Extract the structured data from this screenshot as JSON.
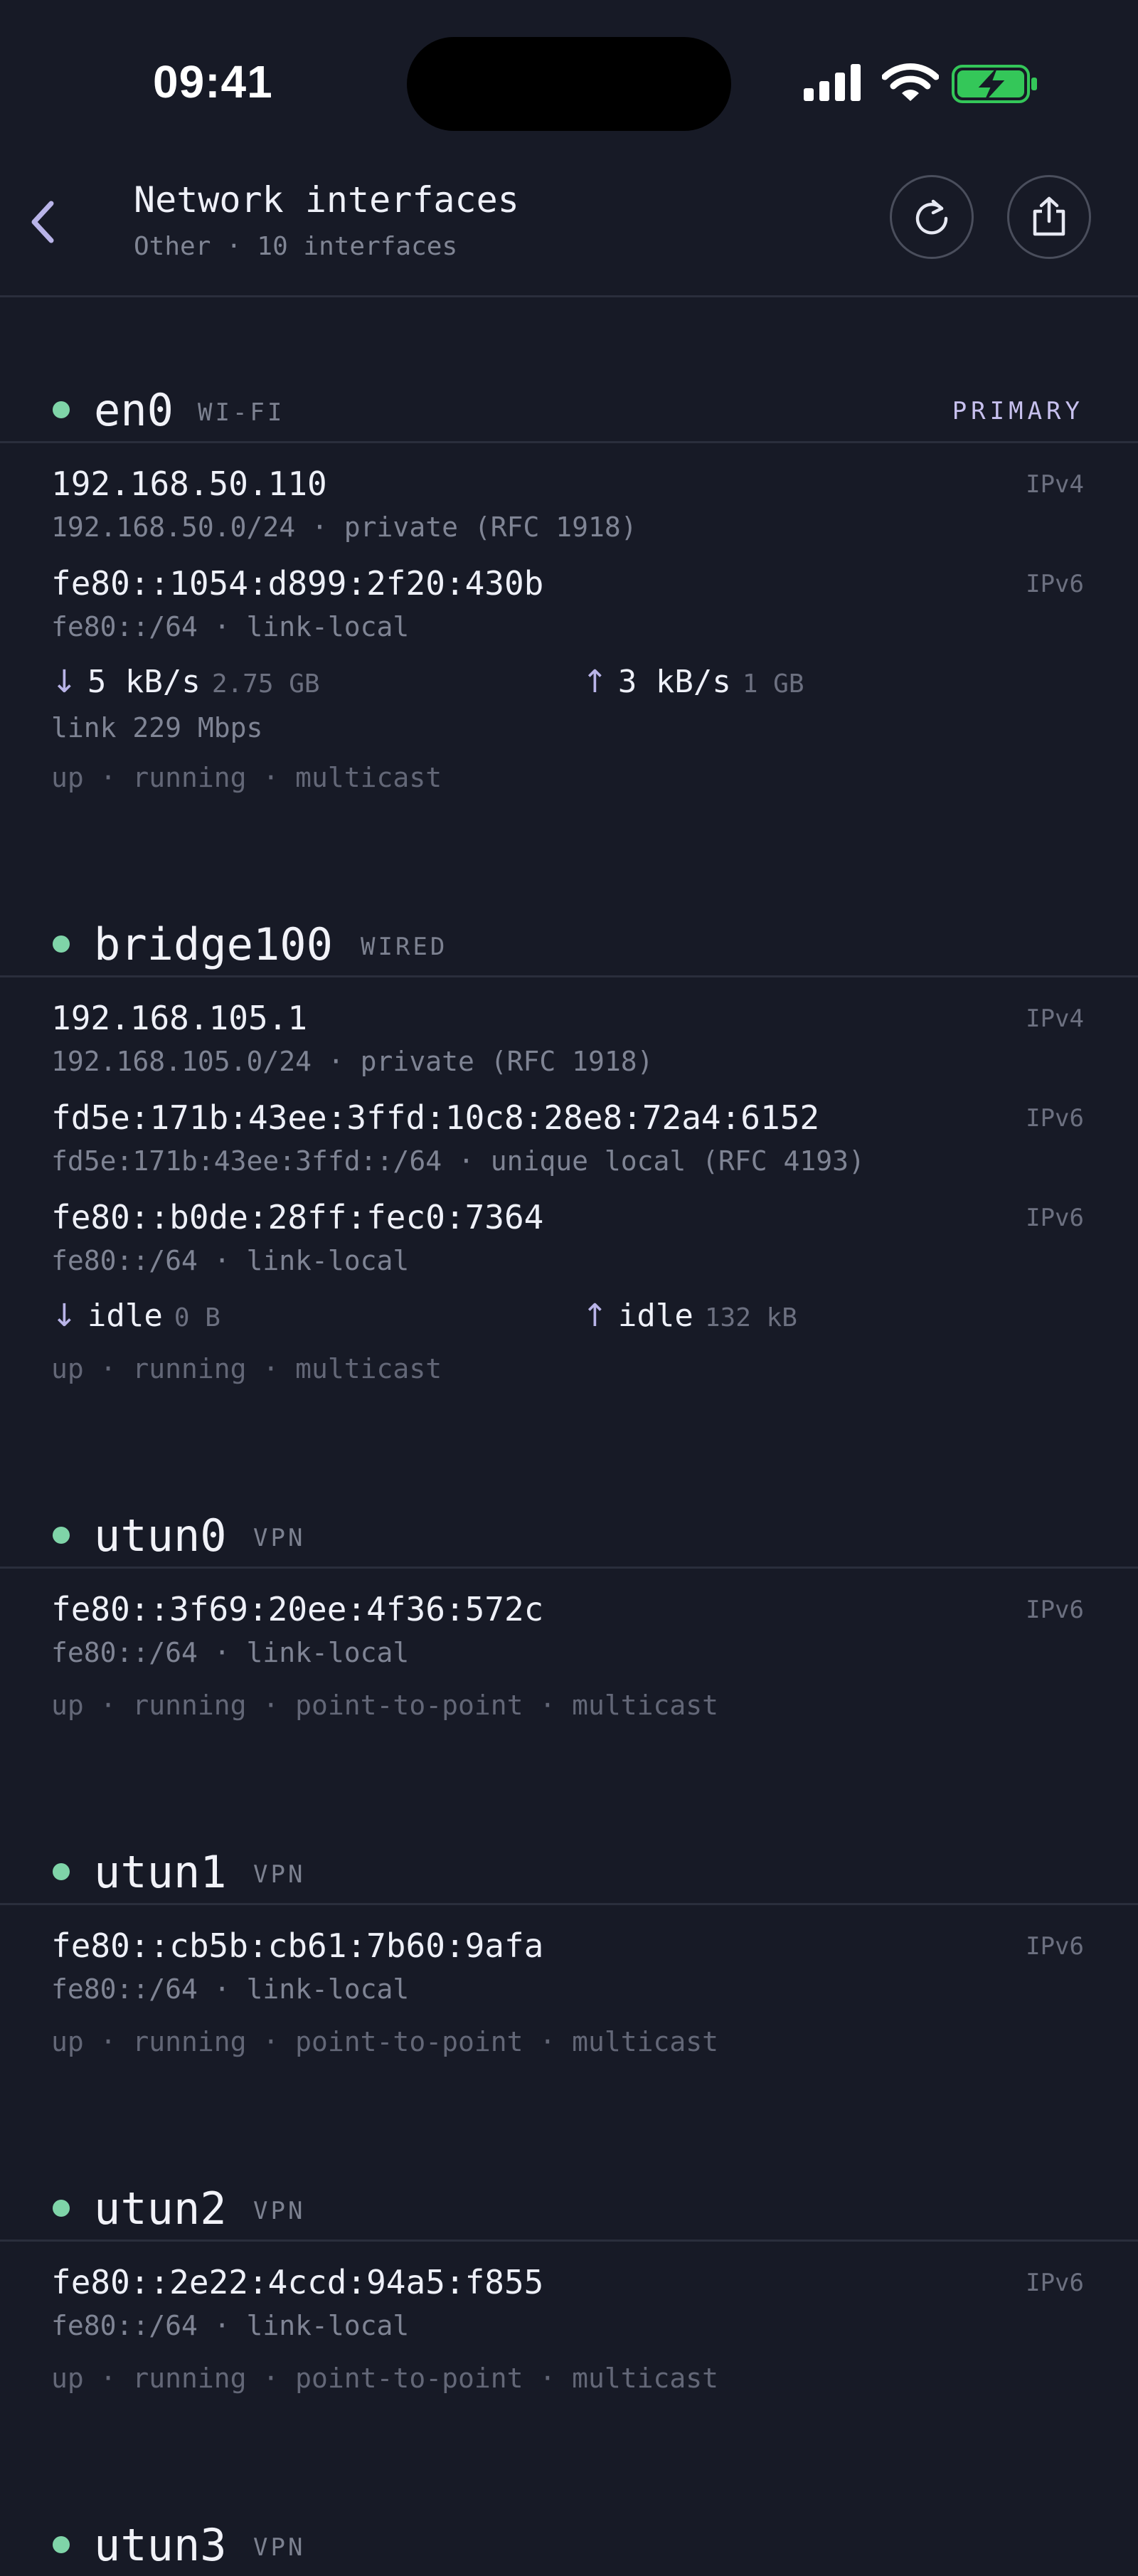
{
  "status": {
    "time": "09:41"
  },
  "header": {
    "title": "Network interfaces",
    "subtitle": "Other · 10 interfaces"
  },
  "colors": {
    "accent": "#b9b4e8",
    "up_dot": "#7fd4a8",
    "battery": "#34c759",
    "background": "#171a26"
  },
  "interfaces": [
    {
      "name": "en0",
      "kind": "WI-FI",
      "badge": "PRIMARY",
      "addresses": [
        {
          "ip": "192.168.50.110",
          "type": "IPv4",
          "sub": "192.168.50.0/24 · private (RFC 1918)"
        },
        {
          "ip": "fe80::1054:d899:2f20:430b",
          "type": "IPv6",
          "sub": "fe80::/64 · link-local"
        }
      ],
      "traffic": {
        "down_rate": "5 kB/s",
        "down_total": "2.75 GB",
        "up_rate": "3 kB/s",
        "up_total": "1 GB"
      },
      "link": "link 229 Mbps",
      "flags": "up · running · multicast"
    },
    {
      "name": "bridge100",
      "kind": "WIRED",
      "addresses": [
        {
          "ip": "192.168.105.1",
          "type": "IPv4",
          "sub": "192.168.105.0/24 · private (RFC 1918)"
        },
        {
          "ip": "fd5e:171b:43ee:3ffd:10c8:28e8:72a4:6152",
          "type": "IPv6",
          "sub": "fd5e:171b:43ee:3ffd::/64 · unique local (RFC 4193)"
        },
        {
          "ip": "fe80::b0de:28ff:fec0:7364",
          "type": "IPv6",
          "sub": "fe80::/64 · link-local"
        }
      ],
      "traffic": {
        "down_rate": "idle",
        "down_total": "0 B",
        "up_rate": "idle",
        "up_total": "132 kB"
      },
      "flags": "up · running · multicast"
    },
    {
      "name": "utun0",
      "kind": "VPN",
      "addresses": [
        {
          "ip": "fe80::3f69:20ee:4f36:572c",
          "type": "IPv6",
          "sub": "fe80::/64 · link-local"
        }
      ],
      "flags": "up · running · point-to-point · multicast"
    },
    {
      "name": "utun1",
      "kind": "VPN",
      "addresses": [
        {
          "ip": "fe80::cb5b:cb61:7b60:9afa",
          "type": "IPv6",
          "sub": "fe80::/64 · link-local"
        }
      ],
      "flags": "up · running · point-to-point · multicast"
    },
    {
      "name": "utun2",
      "kind": "VPN",
      "addresses": [
        {
          "ip": "fe80::2e22:4ccd:94a5:f855",
          "type": "IPv6",
          "sub": "fe80::/64 · link-local"
        }
      ],
      "flags": "up · running · point-to-point · multicast"
    },
    {
      "name": "utun3",
      "kind": "VPN",
      "addresses": [],
      "flags": ""
    }
  ]
}
